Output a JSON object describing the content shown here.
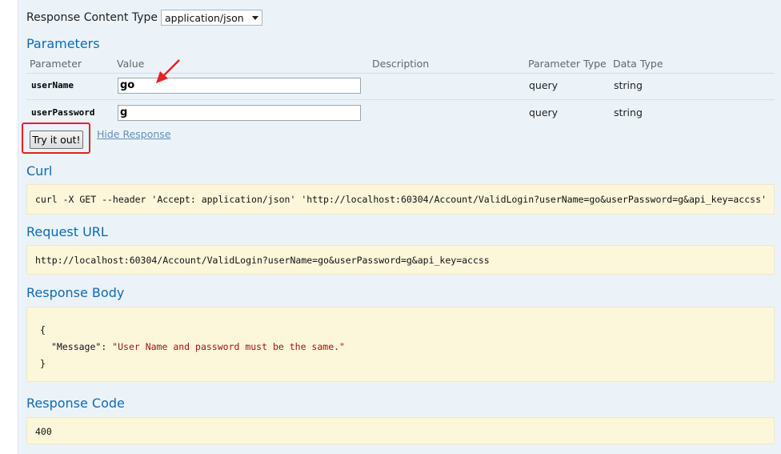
{
  "response_content_type": {
    "label": "Response Content Type",
    "selected": "application/json"
  },
  "parameters": {
    "title": "Parameters",
    "headers": {
      "parameter": "Parameter",
      "value": "Value",
      "description": "Description",
      "parameter_type": "Parameter Type",
      "data_type": "Data Type"
    },
    "rows": [
      {
        "name": "userName",
        "value": "go",
        "param_type": "query",
        "data_type": "string"
      },
      {
        "name": "userPassword",
        "value": "g",
        "param_type": "query",
        "data_type": "string"
      }
    ]
  },
  "actions": {
    "try_label": "Try it out!",
    "hide_label": "Hide Response"
  },
  "curl": {
    "title": "Curl",
    "command": "curl -X GET --header 'Accept: application/json' 'http://localhost:60304/Account/ValidLogin?userName=go&userPassword=g&api_key=accss'"
  },
  "request_url": {
    "title": "Request URL",
    "url": "http://localhost:60304/Account/ValidLogin?userName=go&userPassword=g&api_key=accss"
  },
  "response_body": {
    "title": "Response Body",
    "open_brace": "{",
    "key": "\"Message\"",
    "colon": ": ",
    "value": "\"User Name and password must be the same.\"",
    "close_brace": "}"
  },
  "response_code": {
    "title": "Response Code",
    "code": "400"
  },
  "colors": {
    "panel_bg": "#ebf3f9",
    "heading_blue": "#0f6ab4",
    "code_bg": "#fcf6db",
    "annotation_red": "#e52222"
  }
}
